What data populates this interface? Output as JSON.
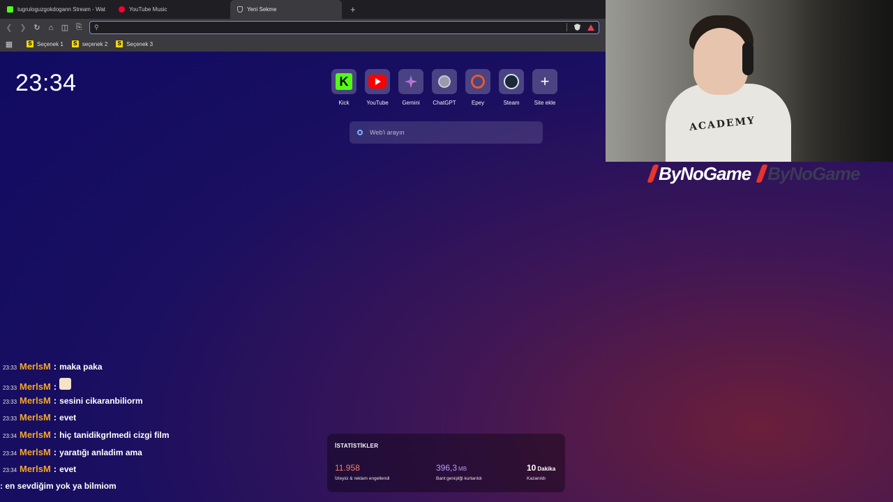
{
  "browser": {
    "tabs": [
      {
        "title": "tugruloguzgokdogann Stream - Wat",
        "icon": "kick-icon"
      },
      {
        "title": "YouTube Music",
        "icon": "youtube-music-icon"
      },
      {
        "title": "Yeni Sekme",
        "icon": "brave-icon",
        "active": true
      }
    ],
    "address_value": "",
    "bookmarks": [
      "Seçenek 1",
      "seçenek 2",
      "Seçenek 3"
    ],
    "bookmark_icon_letter": "S"
  },
  "newtab": {
    "clock": "23:34",
    "top_sites": [
      {
        "label": "Kick",
        "icon": "kick-logo-icon"
      },
      {
        "label": "YouTube",
        "icon": "youtube-logo-icon"
      },
      {
        "label": "Gemini",
        "icon": "gemini-logo-icon"
      },
      {
        "label": "ChatGPT",
        "icon": "globe-icon"
      },
      {
        "label": "Epey",
        "icon": "epey-logo-icon"
      },
      {
        "label": "Steam",
        "icon": "steam-logo-icon"
      },
      {
        "label": "Site ekle",
        "icon": "plus-icon"
      }
    ],
    "kick_letter": "K",
    "plus_glyph": "+",
    "search_placeholder": "Web'i arayın"
  },
  "stream": {
    "brand": "ByNoGame",
    "shirt_text": "ACADEMY"
  },
  "chat": [
    {
      "time": "23:33",
      "user": "MerlsM",
      "text": "maka paka"
    },
    {
      "time": "23:33",
      "user": "MerlsM",
      "text": "",
      "emote": true
    },
    {
      "time": "23:33",
      "user": "MerlsM",
      "text": "sesini cikaranbiliorm"
    },
    {
      "time": "23:33",
      "user": "MerlsM",
      "text": "evet"
    },
    {
      "time": "23:34",
      "user": "MerlsM",
      "text": "hiç tanidikgrlmedi cizgi film"
    },
    {
      "time": "23:34",
      "user": "MerlsM",
      "text": "yaratığı anladim ama"
    },
    {
      "time": "23:34",
      "user": "MerlsM",
      "text": "evet"
    },
    {
      "time": "",
      "user": "",
      "text": ": en sevdiğim yok ya bilmiom"
    }
  ],
  "stats": {
    "title": "İSTATİSTİKLER",
    "items": [
      {
        "value": "11.958",
        "unit": "",
        "desc": "İzleyici & reklam engellendi"
      },
      {
        "value": "396,3",
        "unit": "MB",
        "desc": "Bant genişliği kurtarıldı"
      },
      {
        "value": "10",
        "unit": "Dakika",
        "desc": "Kazanıldı"
      }
    ]
  }
}
